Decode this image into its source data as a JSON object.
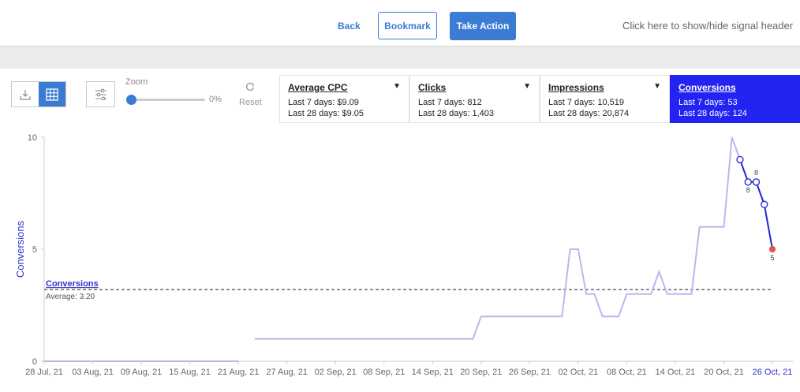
{
  "header": {
    "back_label": "Back",
    "bookmark_label": "Bookmark",
    "action_label": "Take Action",
    "toggle_label": "Click here to show/hide signal header"
  },
  "toolbar": {
    "zoom_label": "Zoom",
    "zoom_value": "0%",
    "reset_label": "Reset",
    "icons": [
      "download-icon",
      "table-icon",
      "sliders-icon",
      "reset-icon"
    ]
  },
  "metrics": [
    {
      "name": "Average CPC",
      "line1": "Last 7 days: $9.09",
      "line2": "Last 28 days: $9.05",
      "active": false
    },
    {
      "name": "Clicks",
      "line1": "Last 7 days: 812",
      "line2": "Last 28 days: 1,403",
      "active": false
    },
    {
      "name": "Impressions",
      "line1": "Last 7 days: 10,519",
      "line2": "Last 28 days: 20,874",
      "active": false
    },
    {
      "name": "Conversions",
      "line1": "Last 7 days: 53",
      "line2": "Last 28 days: 124",
      "active": true
    }
  ],
  "colors": {
    "accent": "#3b7bd4",
    "active_metric": "#2323f2",
    "line_light": "#b8b8f0",
    "line_dark": "#2323d8",
    "last_point": "#e05555"
  },
  "chart_data": {
    "type": "line",
    "ylabel": "Conversions",
    "ylim": [
      0,
      10
    ],
    "yticks": [
      "0",
      "5",
      "10"
    ],
    "x_ticks": [
      "28 Jul, 21",
      "03 Aug, 21",
      "09 Aug, 21",
      "15 Aug, 21",
      "21 Aug, 21",
      "27 Aug, 21",
      "02 Sep, 21",
      "08 Sep, 21",
      "14 Sep, 21",
      "20 Sep, 21",
      "26 Sep, 21",
      "02 Oct, 21",
      "08 Oct, 21",
      "14 Oct, 21",
      "20 Oct, 21",
      "26 Oct, 21"
    ],
    "x_ticks_highlight": "26 Oct, 21",
    "average": {
      "label": "Conversions",
      "text": "Average: 3.20",
      "value": 3.2
    },
    "series": [
      {
        "values": [
          [
            "2021-07-28",
            0
          ],
          [
            "2021-08-21",
            0
          ],
          [
            "2021-08-23",
            1
          ],
          [
            "2021-09-19",
            1
          ],
          [
            "2021-09-20",
            2
          ],
          [
            "2021-09-29",
            2
          ],
          [
            "2021-09-30",
            2
          ],
          [
            "2021-10-01",
            5
          ],
          [
            "2021-10-02",
            5
          ],
          [
            "2021-10-03",
            3
          ],
          [
            "2021-10-04",
            3
          ],
          [
            "2021-10-05",
            2
          ],
          [
            "2021-10-07",
            2
          ],
          [
            "2021-10-08",
            3
          ],
          [
            "2021-10-11",
            3
          ],
          [
            "2021-10-12",
            4
          ],
          [
            "2021-10-13",
            3
          ],
          [
            "2021-10-16",
            3
          ],
          [
            "2021-10-17",
            6
          ],
          [
            "2021-10-20",
            6
          ],
          [
            "2021-10-21",
            10
          ],
          [
            "2021-10-22",
            9
          ]
        ]
      },
      {
        "values": [
          [
            "2021-10-22",
            9
          ],
          [
            "2021-10-23",
            8
          ],
          [
            "2021-10-24",
            8
          ],
          [
            "2021-10-25",
            7
          ],
          [
            "2021-10-26",
            5
          ]
        ],
        "point_labels": {
          "2021-10-23": "8",
          "2021-10-24": "8",
          "2021-10-26": "5"
        }
      }
    ]
  }
}
